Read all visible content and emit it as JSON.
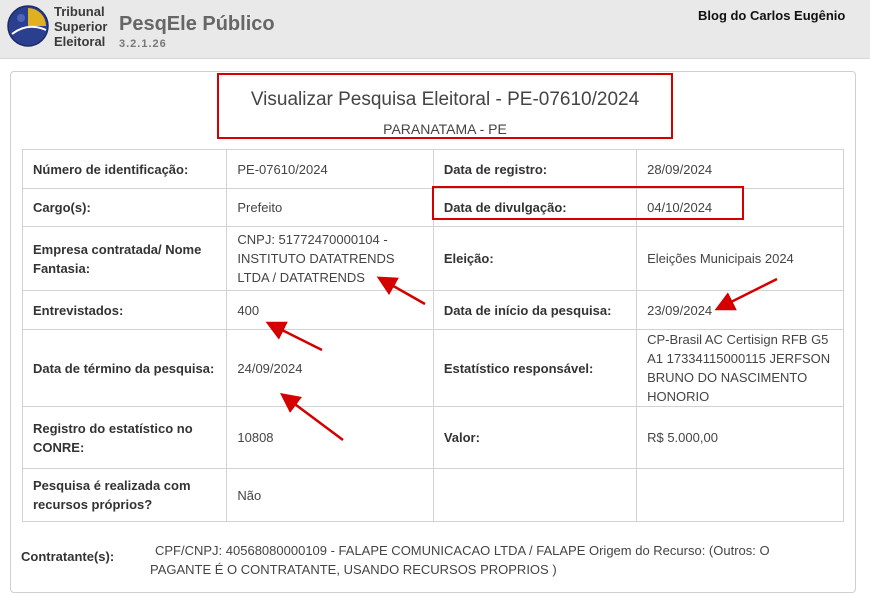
{
  "header": {
    "org_line1": "Tribunal",
    "org_line2": "Superior",
    "org_line3": "Eleitoral",
    "app_title": "PesqEle Público",
    "version": "3.2.1.26",
    "blog": "Blog do Carlos Eugênio"
  },
  "survey": {
    "title": "Visualizar Pesquisa Eleitoral - PE-07610/2024",
    "location": "PARANATAMA - PE"
  },
  "fields": {
    "id_label": "Número de identificação:",
    "id_value": "PE-07610/2024",
    "reg_date_label": "Data de registro:",
    "reg_date_value": "28/09/2024",
    "cargo_label": "Cargo(s):",
    "cargo_value": "Prefeito",
    "div_date_label": "Data de divulgação:",
    "div_date_value": "04/10/2024",
    "empresa_label": "Empresa contratada/ Nome Fantasia:",
    "empresa_value": "CNPJ: 51772470000104 - INSTITUTO DATATRENDS LTDA / DATATRENDS",
    "eleicao_label": "Eleição:",
    "eleicao_value": "Eleições Municipais 2024",
    "entrevistados_label": "Entrevistados:",
    "entrevistados_value": "400",
    "inicio_label": "Data de início da pesquisa:",
    "inicio_value": "23/09/2024",
    "termino_label": "Data de término da pesquisa:",
    "termino_value": "24/09/2024",
    "estatistico_label": "Estatístico responsável:",
    "estatistico_value": "CP-Brasil AC Certisign RFB G5 A1 17334115000115 JERFSON BRUNO DO NASCIMENTO HONORIO",
    "conre_label": "Registro do estatístico no CONRE:",
    "conre_value": "10808",
    "valor_label": "Valor:",
    "valor_value": "R$ 5.000,00",
    "proprios_label": "Pesquisa é realizada com recursos próprios?",
    "proprios_value": "Não"
  },
  "contratante": {
    "label": "Contratante(s):",
    "value": "CPF/CNPJ: 40568080000109 - FALAPE COMUNICACAO LTDA / FALAPE Origem do Recurso: (Outros: O PAGANTE É O CONTRATANTE, USANDO RECURSOS PROPRIOS )"
  },
  "colors": {
    "highlight": "#d40000",
    "emblem_blue": "#2b3f8f",
    "emblem_gold": "#e0b020"
  },
  "icons": [
    "tse-emblem-icon",
    "arrow-annotation-icon"
  ]
}
